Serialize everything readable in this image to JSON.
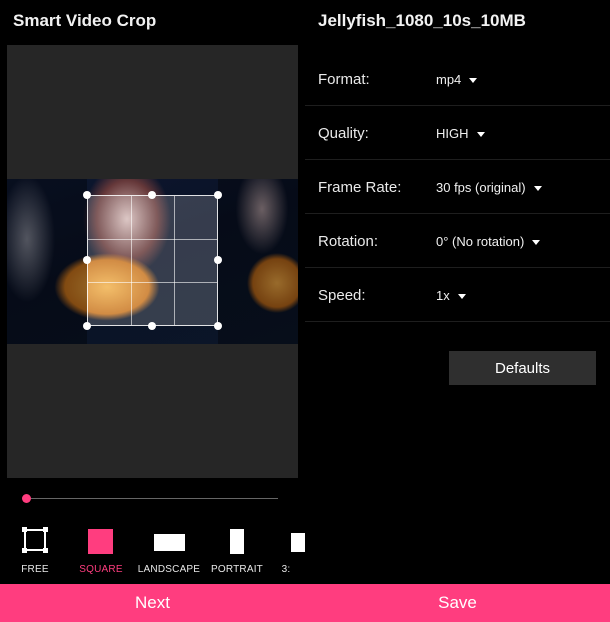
{
  "app": {
    "title": "Smart Video Crop"
  },
  "video": {
    "title": "Jellyfish_1080_10s_10MB"
  },
  "ratios": [
    {
      "label": "FREE",
      "icon": "free-crop-icon",
      "active": false
    },
    {
      "label": "SQUARE",
      "icon": "square-icon",
      "active": true
    },
    {
      "label": "LANDSCAPE",
      "icon": "landscape-icon",
      "active": false
    },
    {
      "label": "PORTRAIT",
      "icon": "portrait-icon",
      "active": false
    },
    {
      "label": "3:",
      "icon": "ratio-icon",
      "active": false
    }
  ],
  "settings": [
    {
      "label": "Format:",
      "value": "mp4"
    },
    {
      "label": "Quality:",
      "value": "HIGH"
    },
    {
      "label": "Frame Rate:",
      "value": "30 fps (original)"
    },
    {
      "label": "Rotation:",
      "value": "0° (No rotation)"
    },
    {
      "label": "Speed:",
      "value": "1x"
    }
  ],
  "defaults_label": "Defaults",
  "bottom": {
    "next_label": "Next",
    "save_label": "Save"
  },
  "colors": {
    "accent": "#ff3d7f",
    "background": "#000000",
    "panel": "#262626"
  },
  "seek": {
    "progress": 0.0
  }
}
